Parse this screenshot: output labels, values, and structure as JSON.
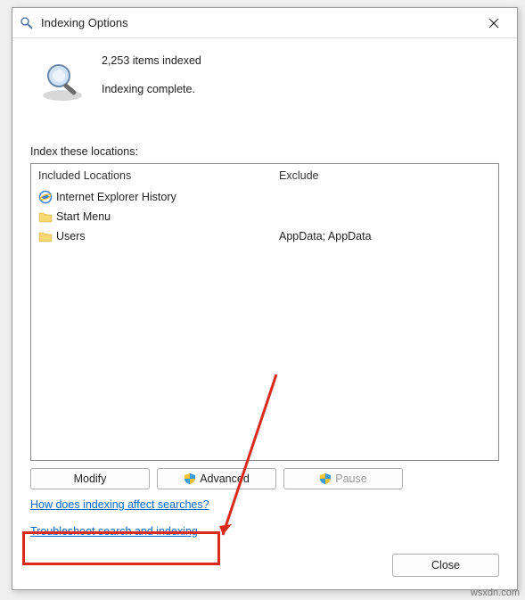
{
  "title": "Indexing Options",
  "status": {
    "count_line": "2,253 items indexed",
    "state_line": "Indexing complete."
  },
  "locations_label": "Index these locations:",
  "columns": {
    "included": "Included Locations",
    "exclude": "Exclude"
  },
  "rows": [
    {
      "icon": "ie",
      "name": "Internet Explorer History",
      "exclude": ""
    },
    {
      "icon": "folder",
      "name": "Start Menu",
      "exclude": ""
    },
    {
      "icon": "folder",
      "name": "Users",
      "exclude": "AppData; AppData"
    }
  ],
  "buttons": {
    "modify": "Modify",
    "advanced": "Advanced",
    "pause": "Pause",
    "close": "Close"
  },
  "links": {
    "how": "How does indexing affect searches?",
    "troubleshoot": "Troubleshoot search and indexing"
  },
  "watermark": "wsxdn.com"
}
